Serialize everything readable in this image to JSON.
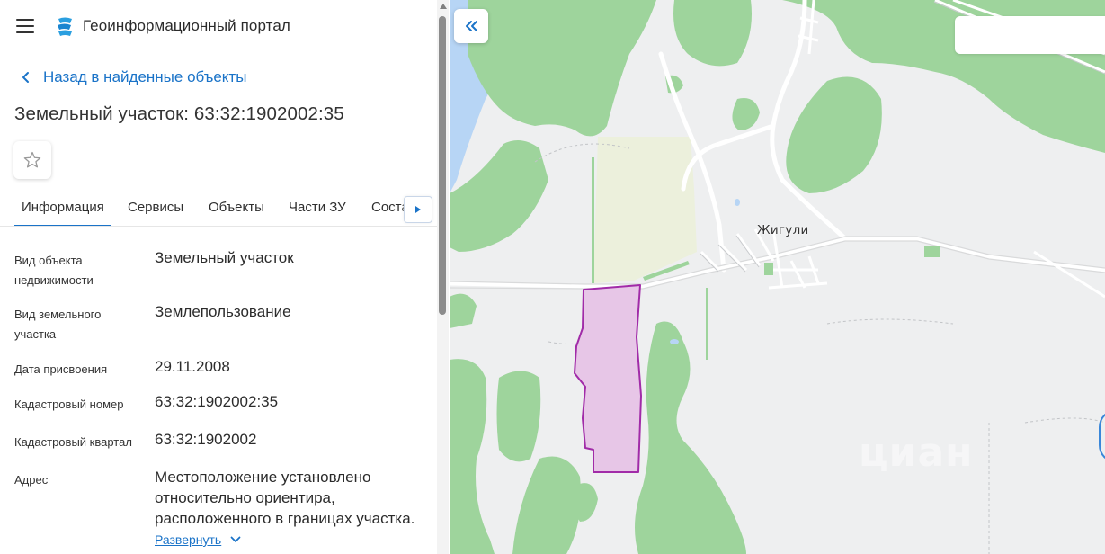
{
  "app": {
    "title": "Геоинформационный портал",
    "menu_icon": "hamburger-menu-icon",
    "logo_icon": "portal-logo-icon"
  },
  "navigation": {
    "back_label": "Назад в найденные объекты"
  },
  "object": {
    "title": "Земельный участок: 63:32:1902002:35",
    "favorite_icon": "star-outline-icon"
  },
  "tabs": [
    {
      "label": "Информация",
      "active": true
    },
    {
      "label": "Сервисы",
      "active": false
    },
    {
      "label": "Объекты",
      "active": false
    },
    {
      "label": "Части ЗУ",
      "active": false
    },
    {
      "label": "Соста",
      "active": false
    }
  ],
  "details": [
    {
      "label": "Вид объекта недвижимости",
      "value": "Земельный участок"
    },
    {
      "label": "Вид земельного участка",
      "value": "Землепользование"
    },
    {
      "label": "Дата присвоения",
      "value": "29.11.2008"
    },
    {
      "label": "Кадастровый номер",
      "value": "63:32:1902002:35"
    },
    {
      "label": "Кадастровый квартал",
      "value": "63:32:1902002"
    },
    {
      "label": "Адрес",
      "value": "Местоположение установлено относительно ориентира, расположенного в границах участка."
    }
  ],
  "expand_label": "Развернуть",
  "map": {
    "place_label": "Жигули",
    "watermark": "циан",
    "colors": {
      "forest": "#9ed49c",
      "water": "#b7d5f5",
      "field": "#ecf0dc",
      "parcel_fill": "#e7c6e7",
      "parcel_stroke": "#a12ba8",
      "accent": "#1a73c8"
    }
  }
}
